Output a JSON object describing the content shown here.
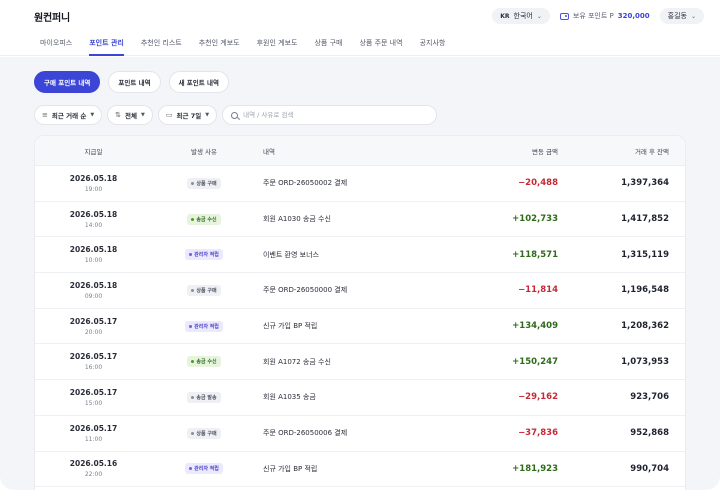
{
  "header": {
    "logo": "원컨퍼니",
    "language": {
      "code": "KR",
      "label": "한국어"
    },
    "points_label": "보유 포인트 P",
    "points_value": "320,000",
    "user": "홍길동"
  },
  "nav": [
    {
      "label": "마이오피스",
      "active": false
    },
    {
      "label": "포인트 관리",
      "active": true
    },
    {
      "label": "추천인 리스트",
      "active": false
    },
    {
      "label": "추천인 계보도",
      "active": false
    },
    {
      "label": "후원인 계보도",
      "active": false
    },
    {
      "label": "상품 구매",
      "active": false
    },
    {
      "label": "상품 주문 내역",
      "active": false
    },
    {
      "label": "공지사항",
      "active": false
    }
  ],
  "subtabs": [
    {
      "label": "구매 포인트 내역",
      "active": true
    },
    {
      "label": "포인트 내역",
      "active": false
    },
    {
      "label": "새 포인트 내역",
      "active": false
    }
  ],
  "filters": {
    "sort": "최근 거래 순",
    "type": "전체",
    "period": "최근 7일",
    "search_placeholder": "내역 / 사유로 검색"
  },
  "table": {
    "headers": [
      "지급일",
      "발생 사유",
      "내역",
      "변동 금액",
      "거래 후 잔액"
    ],
    "rows": [
      {
        "date": "2026.05.18",
        "time": "19:00",
        "type": "상품 구매",
        "badge": "gray",
        "desc": "주문 ORD-26050002 결제",
        "amount": "−20,488",
        "sign": "neg",
        "balance": "1,397,364"
      },
      {
        "date": "2026.05.18",
        "time": "14:00",
        "type": "송금 수신",
        "badge": "green",
        "desc": "회원 A1030 송금 수신",
        "amount": "+102,733",
        "sign": "pos",
        "balance": "1,417,852"
      },
      {
        "date": "2026.05.18",
        "time": "10:00",
        "type": "관리자 적립",
        "badge": "purple",
        "desc": "이벤트 환영 보너스",
        "amount": "+118,571",
        "sign": "pos",
        "balance": "1,315,119"
      },
      {
        "date": "2026.05.18",
        "time": "09:00",
        "type": "상품 구매",
        "badge": "gray",
        "desc": "주문 ORD-26050000 결제",
        "amount": "−11,814",
        "sign": "neg",
        "balance": "1,196,548"
      },
      {
        "date": "2026.05.17",
        "time": "20:00",
        "type": "관리자 적립",
        "badge": "purple",
        "desc": "신규 가입 BP 적립",
        "amount": "+134,409",
        "sign": "pos",
        "balance": "1,208,362"
      },
      {
        "date": "2026.05.17",
        "time": "16:00",
        "type": "송금 수신",
        "badge": "green",
        "desc": "회원 A1072 송금 수신",
        "amount": "+150,247",
        "sign": "pos",
        "balance": "1,073,953"
      },
      {
        "date": "2026.05.17",
        "time": "15:00",
        "type": "송금 발송",
        "badge": "gray",
        "desc": "회원 A1035 송금",
        "amount": "−29,162",
        "sign": "neg",
        "balance": "923,706"
      },
      {
        "date": "2026.05.17",
        "time": "11:00",
        "type": "상품 구매",
        "badge": "gray",
        "desc": "주문 ORD-26050006 결제",
        "amount": "−37,836",
        "sign": "neg",
        "balance": "952,868"
      },
      {
        "date": "2026.05.16",
        "time": "22:00",
        "type": "관리자 적립",
        "badge": "purple",
        "desc": "신규 가입 BP 적립",
        "amount": "+181,923",
        "sign": "pos",
        "balance": "990,704"
      }
    ]
  }
}
